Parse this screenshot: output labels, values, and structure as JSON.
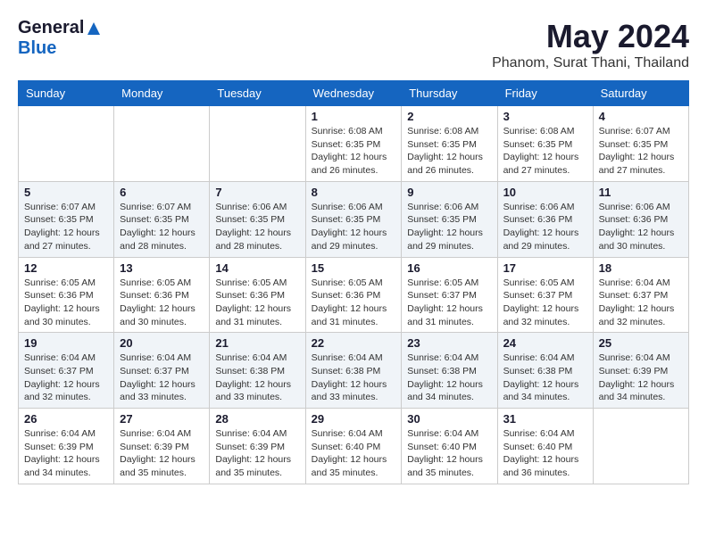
{
  "logo": {
    "general": "General",
    "blue": "Blue"
  },
  "title": {
    "month_year": "May 2024",
    "location": "Phanom, Surat Thani, Thailand"
  },
  "headers": [
    "Sunday",
    "Monday",
    "Tuesday",
    "Wednesday",
    "Thursday",
    "Friday",
    "Saturday"
  ],
  "weeks": [
    [
      {
        "day": "",
        "info": ""
      },
      {
        "day": "",
        "info": ""
      },
      {
        "day": "",
        "info": ""
      },
      {
        "day": "1",
        "info": "Sunrise: 6:08 AM\nSunset: 6:35 PM\nDaylight: 12 hours\nand 26 minutes."
      },
      {
        "day": "2",
        "info": "Sunrise: 6:08 AM\nSunset: 6:35 PM\nDaylight: 12 hours\nand 26 minutes."
      },
      {
        "day": "3",
        "info": "Sunrise: 6:08 AM\nSunset: 6:35 PM\nDaylight: 12 hours\nand 27 minutes."
      },
      {
        "day": "4",
        "info": "Sunrise: 6:07 AM\nSunset: 6:35 PM\nDaylight: 12 hours\nand 27 minutes."
      }
    ],
    [
      {
        "day": "5",
        "info": "Sunrise: 6:07 AM\nSunset: 6:35 PM\nDaylight: 12 hours\nand 27 minutes."
      },
      {
        "day": "6",
        "info": "Sunrise: 6:07 AM\nSunset: 6:35 PM\nDaylight: 12 hours\nand 28 minutes."
      },
      {
        "day": "7",
        "info": "Sunrise: 6:06 AM\nSunset: 6:35 PM\nDaylight: 12 hours\nand 28 minutes."
      },
      {
        "day": "8",
        "info": "Sunrise: 6:06 AM\nSunset: 6:35 PM\nDaylight: 12 hours\nand 29 minutes."
      },
      {
        "day": "9",
        "info": "Sunrise: 6:06 AM\nSunset: 6:35 PM\nDaylight: 12 hours\nand 29 minutes."
      },
      {
        "day": "10",
        "info": "Sunrise: 6:06 AM\nSunset: 6:36 PM\nDaylight: 12 hours\nand 29 minutes."
      },
      {
        "day": "11",
        "info": "Sunrise: 6:06 AM\nSunset: 6:36 PM\nDaylight: 12 hours\nand 30 minutes."
      }
    ],
    [
      {
        "day": "12",
        "info": "Sunrise: 6:05 AM\nSunset: 6:36 PM\nDaylight: 12 hours\nand 30 minutes."
      },
      {
        "day": "13",
        "info": "Sunrise: 6:05 AM\nSunset: 6:36 PM\nDaylight: 12 hours\nand 30 minutes."
      },
      {
        "day": "14",
        "info": "Sunrise: 6:05 AM\nSunset: 6:36 PM\nDaylight: 12 hours\nand 31 minutes."
      },
      {
        "day": "15",
        "info": "Sunrise: 6:05 AM\nSunset: 6:36 PM\nDaylight: 12 hours\nand 31 minutes."
      },
      {
        "day": "16",
        "info": "Sunrise: 6:05 AM\nSunset: 6:37 PM\nDaylight: 12 hours\nand 31 minutes."
      },
      {
        "day": "17",
        "info": "Sunrise: 6:05 AM\nSunset: 6:37 PM\nDaylight: 12 hours\nand 32 minutes."
      },
      {
        "day": "18",
        "info": "Sunrise: 6:04 AM\nSunset: 6:37 PM\nDaylight: 12 hours\nand 32 minutes."
      }
    ],
    [
      {
        "day": "19",
        "info": "Sunrise: 6:04 AM\nSunset: 6:37 PM\nDaylight: 12 hours\nand 32 minutes."
      },
      {
        "day": "20",
        "info": "Sunrise: 6:04 AM\nSunset: 6:37 PM\nDaylight: 12 hours\nand 33 minutes."
      },
      {
        "day": "21",
        "info": "Sunrise: 6:04 AM\nSunset: 6:38 PM\nDaylight: 12 hours\nand 33 minutes."
      },
      {
        "day": "22",
        "info": "Sunrise: 6:04 AM\nSunset: 6:38 PM\nDaylight: 12 hours\nand 33 minutes."
      },
      {
        "day": "23",
        "info": "Sunrise: 6:04 AM\nSunset: 6:38 PM\nDaylight: 12 hours\nand 34 minutes."
      },
      {
        "day": "24",
        "info": "Sunrise: 6:04 AM\nSunset: 6:38 PM\nDaylight: 12 hours\nand 34 minutes."
      },
      {
        "day": "25",
        "info": "Sunrise: 6:04 AM\nSunset: 6:39 PM\nDaylight: 12 hours\nand 34 minutes."
      }
    ],
    [
      {
        "day": "26",
        "info": "Sunrise: 6:04 AM\nSunset: 6:39 PM\nDaylight: 12 hours\nand 34 minutes."
      },
      {
        "day": "27",
        "info": "Sunrise: 6:04 AM\nSunset: 6:39 PM\nDaylight: 12 hours\nand 35 minutes."
      },
      {
        "day": "28",
        "info": "Sunrise: 6:04 AM\nSunset: 6:39 PM\nDaylight: 12 hours\nand 35 minutes."
      },
      {
        "day": "29",
        "info": "Sunrise: 6:04 AM\nSunset: 6:40 PM\nDaylight: 12 hours\nand 35 minutes."
      },
      {
        "day": "30",
        "info": "Sunrise: 6:04 AM\nSunset: 6:40 PM\nDaylight: 12 hours\nand 35 minutes."
      },
      {
        "day": "31",
        "info": "Sunrise: 6:04 AM\nSunset: 6:40 PM\nDaylight: 12 hours\nand 36 minutes."
      },
      {
        "day": "",
        "info": ""
      }
    ]
  ]
}
